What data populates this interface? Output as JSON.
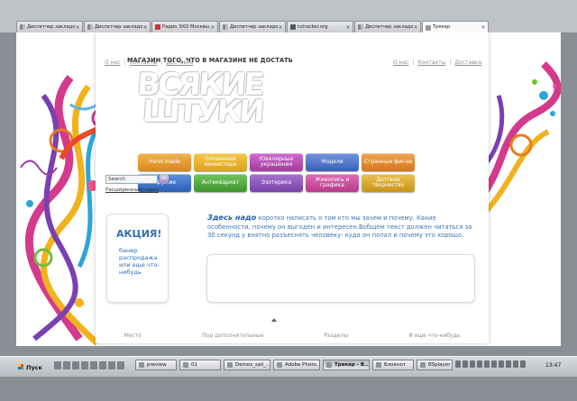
{
  "tabs": [
    {
      "label": "Диспетчер закладок"
    },
    {
      "label": "Диспетчер закладок"
    },
    {
      "label": "Радио ЭХО Москвы..."
    },
    {
      "label": "Диспетчер закладок"
    },
    {
      "label": "rutracker.org"
    },
    {
      "label": "Диспетчер закладок"
    },
    {
      "label": "Трекер"
    }
  ],
  "nav": {
    "about": "О нас",
    "contacts": "Контакты",
    "delivery": "Доставка"
  },
  "tagline": "МАГАЗИН ТОГО, ЧТО В МАГАЗИНЕ НЕ ДОСТАТЬ",
  "logo": {
    "line1": "ВСЯКИЕ",
    "line2": "ШТУКИ"
  },
  "categories": {
    "row1": [
      {
        "label": "Hand made",
        "color": "#e39a2c"
      },
      {
        "label": "Оловянная миниатюра",
        "color": "#e9b32a"
      },
      {
        "label": "Ювелирные украшения",
        "color": "#b54fb1"
      },
      {
        "label": "Модели",
        "color": "#4f73c9"
      },
      {
        "label": "Странные фигни",
        "color": "#e38a2a"
      }
    ],
    "row2": [
      {
        "label": "Оружие",
        "color": "#3c72c5"
      },
      {
        "label": "Антиквариат",
        "color": "#4faa3c"
      },
      {
        "label": "Эзотерика",
        "color": "#8b52b8"
      },
      {
        "label": "Живопись и графика",
        "color": "#c94a9a"
      },
      {
        "label": "Детское творчество",
        "color": "#d9a72b"
      }
    ]
  },
  "search": {
    "placeholder": "Search",
    "button": "ok",
    "advanced": "Расширенный поиск"
  },
  "promo": {
    "title": "АКЦИЯ!",
    "body": "банер распродажа или еще что-нибудь"
  },
  "intro": {
    "lead": "Здесь надо",
    "text": "коротко написать о том кто мы зачем и почему. Какие особенности, почему он выгоден и интересен.Вобщем текст должен читаться за 30 секунд у внятно разъеснять человеку- куда он попал и почему это хорошо."
  },
  "footer": [
    "Место",
    "Под дополнительные",
    "Разделы",
    "И еще что-нибудь"
  ],
  "taskbar": {
    "start": "Пуск",
    "tasks": [
      "preview",
      "01",
      "Demos_sail_...",
      "Adobe Photo...",
      "Трекер - B...",
      "Блокнот",
      "BSplayer"
    ],
    "clock": "13:47"
  }
}
